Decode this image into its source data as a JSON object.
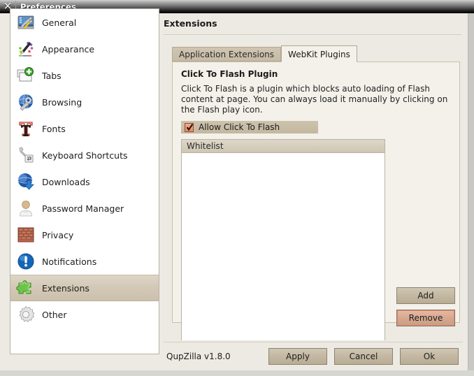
{
  "window": {
    "title": "Preferences",
    "close_icon": "close-x-icon"
  },
  "sidebar": {
    "items": [
      {
        "label": "General",
        "icon": "general-icon"
      },
      {
        "label": "Appearance",
        "icon": "appearance-icon"
      },
      {
        "label": "Tabs",
        "icon": "tabs-icon"
      },
      {
        "label": "Browsing",
        "icon": "browsing-icon"
      },
      {
        "label": "Fonts",
        "icon": "fonts-icon"
      },
      {
        "label": "Keyboard Shortcuts",
        "icon": "keyboard-shortcuts-icon"
      },
      {
        "label": "Downloads",
        "icon": "downloads-icon"
      },
      {
        "label": "Password Manager",
        "icon": "password-manager-icon"
      },
      {
        "label": "Privacy",
        "icon": "privacy-icon"
      },
      {
        "label": "Notifications",
        "icon": "notifications-icon"
      },
      {
        "label": "Extensions",
        "icon": "extensions-icon",
        "selected": true
      },
      {
        "label": "Other",
        "icon": "other-icon"
      }
    ]
  },
  "pane": {
    "title": "Extensions",
    "tabs": [
      {
        "label": "Application Extensions",
        "active": false
      },
      {
        "label": "WebKit Plugins",
        "active": true
      }
    ],
    "group": {
      "title": "Click To Flash Plugin",
      "description": "Click To Flash is a plugin which blocks auto loading of Flash content at page. You can always load it manually by clicking on the Flash play icon.",
      "checkbox": {
        "label": "Allow Click To Flash",
        "checked": true
      },
      "list": {
        "header": "Whitelist",
        "rows": []
      },
      "buttons": {
        "add": "Add",
        "remove": "Remove"
      }
    }
  },
  "footer": {
    "version": "QupZilla v1.8.0",
    "apply": "Apply",
    "cancel": "Cancel",
    "ok": "Ok"
  },
  "colors": {
    "background": "#edeae3",
    "selection": "#d2c8b5",
    "accent_red": "#e98a66",
    "tab_inactive": "#c6bba5",
    "panel": "#f3f1ea"
  }
}
